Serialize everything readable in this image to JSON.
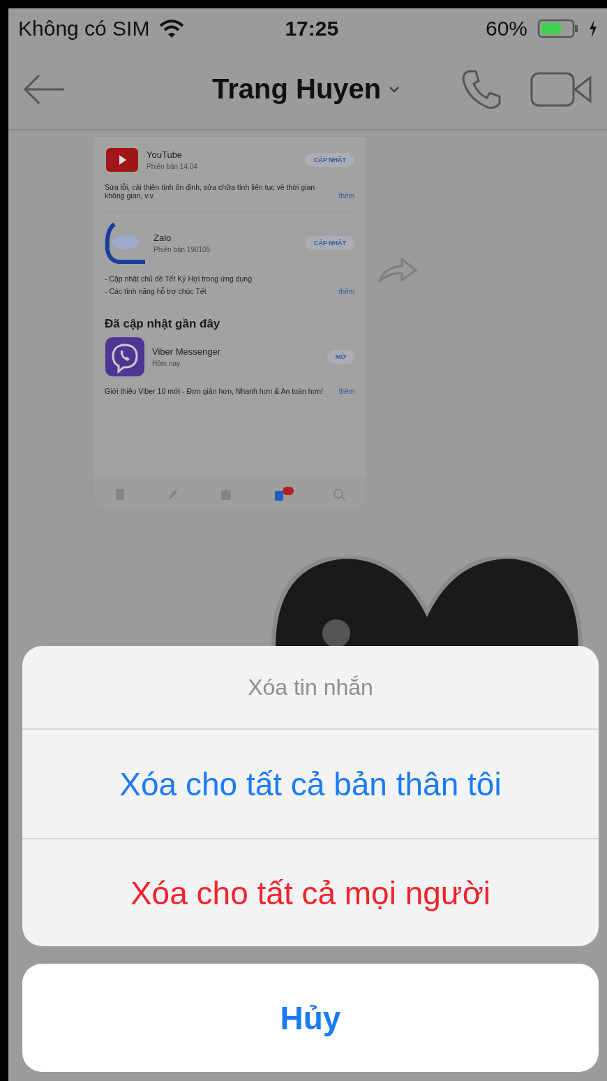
{
  "status_bar": {
    "carrier": "Không có SIM",
    "time": "17:25",
    "battery": "60%"
  },
  "header": {
    "title": "Trang Huyen"
  },
  "messages": [
    {
      "kind": "image",
      "updates": [
        {
          "kind": "youtube",
          "name": "YouTube",
          "version": "Phiên bản 14.04",
          "button": "CẬP NHẬT",
          "notes": [
            "Sửa lỗi, cải thiện tính ổn định, sửa chữa tính liên tục về thời gian không gian, v.v."
          ],
          "more": "thêm"
        },
        {
          "kind": "zalo",
          "name": "Zalo",
          "version": "Phiên bản 190105",
          "button": "CẬP NHẬT",
          "notes": [
            "- Cập nhật chủ đề Tết Kỷ Hợi trong ứng dụng",
            "- Các tính năng hỗ trợ chúc Tết"
          ],
          "more": "thêm"
        }
      ],
      "recent_title": "Đã cập nhật gần đây",
      "recent": [
        {
          "kind": "viber",
          "name": "Viber Messenger",
          "version": "Hôm nay",
          "button": "MỞ",
          "notes": [
            "Giới thiệu Viber 10 mới - Đơn giản hơn, Nhanh hơn & An toàn hơn!"
          ],
          "more": "thêm"
        }
      ],
      "tabs": [
        {
          "selected": false
        },
        {
          "selected": false
        },
        {
          "selected": false
        },
        {
          "selected": true
        },
        {
          "selected": false
        }
      ]
    },
    {
      "kind": "sticker"
    }
  ],
  "action_sheet": {
    "title": "Xóa tin nhắn",
    "actions": [
      {
        "label": "Xóa cho tất cả bản thân tôi",
        "kind": "default"
      },
      {
        "label": "Xóa cho tất cả mọi người",
        "kind": "destructive"
      }
    ],
    "cancel": "Hủy"
  }
}
